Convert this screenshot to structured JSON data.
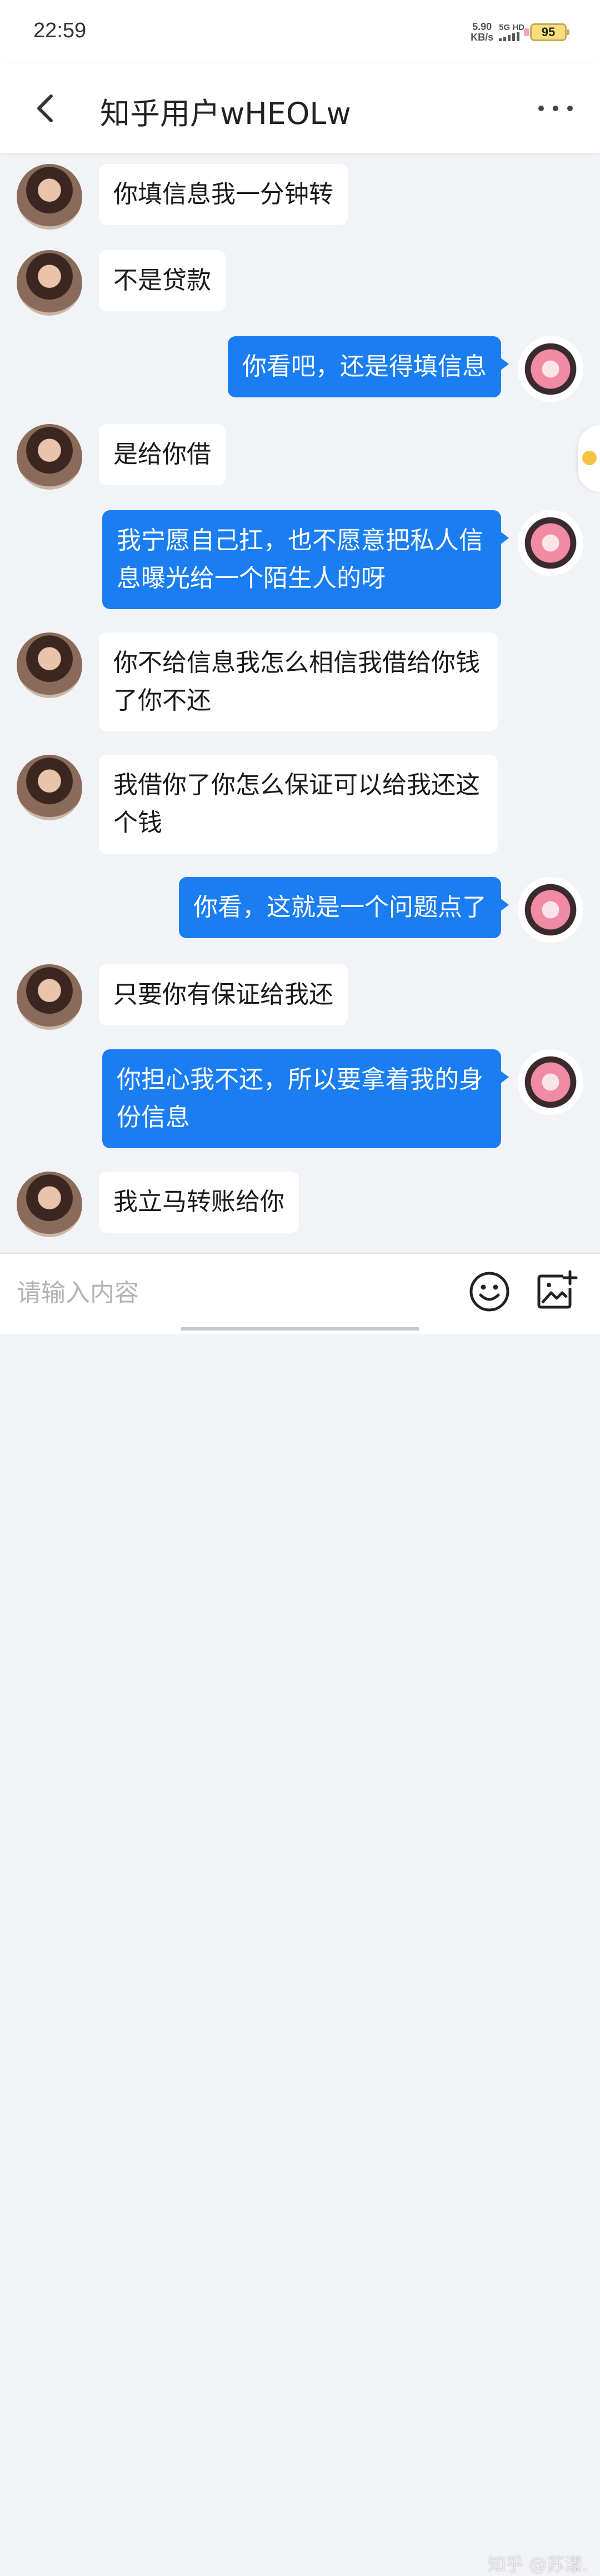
{
  "status_bar": {
    "time": "22:59",
    "net_speed_value": "5.90",
    "net_speed_unit": "KB/s",
    "network_label": "5G HD",
    "battery": "95"
  },
  "header": {
    "title": "知乎用户wHEOLw"
  },
  "messages": [
    {
      "sender": "other",
      "text": "你填信息我一分钟转"
    },
    {
      "sender": "other",
      "text": "不是贷款"
    },
    {
      "sender": "self",
      "text": "你看吧，还是得填信息"
    },
    {
      "sender": "other",
      "text": "是给你借"
    },
    {
      "sender": "self",
      "text": "我宁愿自己扛，也不愿意把私人信息曝光给一个陌生人的呀"
    },
    {
      "sender": "other",
      "text": "你不给信息我怎么相信我借给你钱了你不还"
    },
    {
      "sender": "other",
      "text": "我借你了你怎么保证可以给我还这个钱"
    },
    {
      "sender": "self",
      "text": "你看，这就是一个问题点了"
    },
    {
      "sender": "other",
      "text": "只要你有保证给我还"
    },
    {
      "sender": "self",
      "text": "你担心我不还，所以要拿着我的身份信息"
    },
    {
      "sender": "other",
      "text": "我立马转账给你"
    }
  ],
  "input": {
    "placeholder": "请输入内容"
  },
  "watermark": "知乎 @苏漾.",
  "colors": {
    "self_bubble": "#1a7ef2",
    "other_bubble": "#ffffff",
    "chat_background": "#f2f3f6"
  },
  "icons": [
    "back-arrow-icon",
    "more-dots-icon",
    "emoji-icon",
    "add-image-icon"
  ]
}
